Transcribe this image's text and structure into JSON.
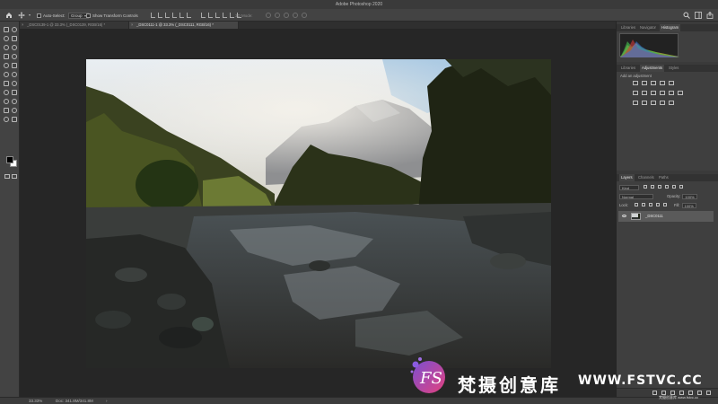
{
  "window": {
    "title": "Adobe Photoshop 2020"
  },
  "options_bar": {
    "auto_select_label": "Auto-Select:",
    "auto_select_value": "Group",
    "show_transform_label": "Show Transform Controls",
    "mode_3d_label": "3D Mode:"
  },
  "tabs": [
    {
      "label": "_DSC0139-1 @ 33.3% (_DSC0139, RGB/16) *",
      "active": false
    },
    {
      "label": "_DSC0111-1 @ 33.3% (_DSC0111, RGB/16) *",
      "active": true
    }
  ],
  "panels": {
    "top_tabs": [
      "Libraries",
      "Navigator",
      "Histogram"
    ],
    "mid_tabs": [
      "Libraries",
      "Adjustments",
      "Styles"
    ],
    "adjustments_hint": "Add an adjustment",
    "layers_tabs": [
      "Layers",
      "Channels",
      "Paths"
    ],
    "kind_label": "Kind",
    "blend_mode": "Normal",
    "opacity_label": "Opacity:",
    "opacity_value": "100%",
    "lock_label": "Lock:",
    "fill_label": "Fill:",
    "fill_value": "100%",
    "layer_name": "_DSC0111"
  },
  "status": {
    "zoom": "33.33%",
    "doc": "Doc: 341.8M/341.8M"
  },
  "watermark": {
    "cn": "梵摄创意库",
    "en": "WWW.FSTVC.CC",
    "small": "梵摄创意库 www.fstvc.cc"
  },
  "colors": {
    "accent": "#e3427f",
    "panel": "#3f3f3f",
    "canvas_bg": "#262626"
  },
  "icons": {
    "home": "home-icon",
    "move": "move-tool-icon",
    "search": "search-icon",
    "workspace": "workspace-icon",
    "share": "share-icon"
  }
}
